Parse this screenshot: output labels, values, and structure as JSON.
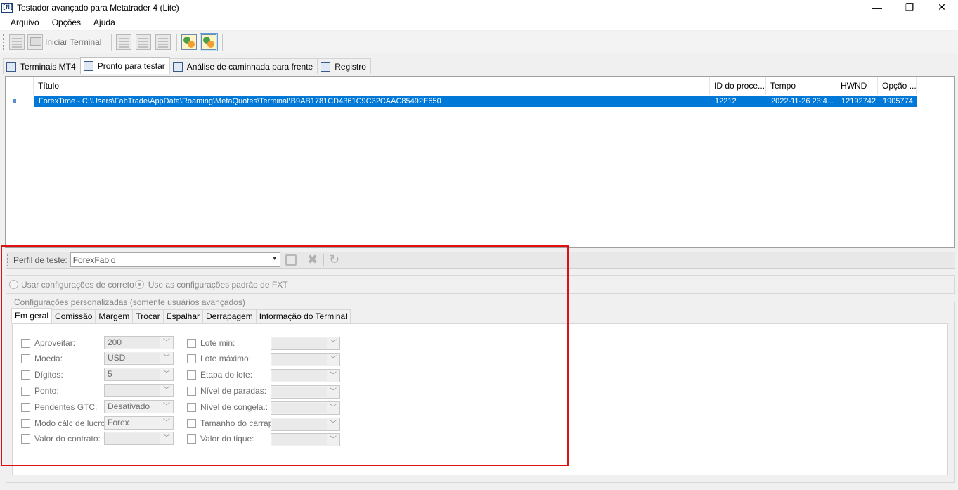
{
  "window": {
    "icon_text": "[N]",
    "title": "Testador avançado para Metatrader 4 (Lite)",
    "minimize": "—",
    "maximize": "❐",
    "close": "✕"
  },
  "menu": [
    "Arquivo",
    "Opções",
    "Ajuda"
  ],
  "toolbar": {
    "start_terminal_label": "Iniciar Terminal",
    "icons": [
      "add-terminal-icon",
      "start-terminal-icon",
      "edit-icon",
      "save-icon",
      "delete-icon",
      "view-terminal-icon",
      "link-terminal-icon"
    ]
  },
  "main_tabs": [
    "Terminais MT4",
    "Pronto para testar",
    "Análise de caminhada para frente",
    "Registro"
  ],
  "grid": {
    "columns": [
      "Título",
      "ID do proce...",
      "Tempo",
      "HWND",
      "Opção ..."
    ],
    "rows": [
      {
        "title": "ForexTime - C:\\Users\\FabTrade\\AppData\\Roaming\\MetaQuotes\\Terminal\\B9AB1781CD4361C9C32CAAC85492E650",
        "pid": "12212",
        "time": "2022-11-26 23:4...",
        "hwnd": "12192742",
        "option": "1905774",
        "selected": true
      }
    ]
  },
  "profile": {
    "label": "Perfil de teste:",
    "value": "ForexFabio"
  },
  "radios": {
    "use_broker": "Usar configurações de correto",
    "use_fxt": "Use as configurações padrão de FXT",
    "selected": "use_fxt"
  },
  "custom_settings": {
    "title": "Configurações personalizadas (somente usuários avançados)",
    "tabs": [
      "Em geral",
      "Comissão",
      "Margem",
      "Trocar",
      "Espalhar",
      "Derrapagem",
      "Informação do Terminal"
    ],
    "left_fields": [
      {
        "label": "Aproveitar:",
        "value": "200"
      },
      {
        "label": "Moeda:",
        "value": "USD"
      },
      {
        "label": "Dígitos:",
        "value": "5"
      },
      {
        "label": "Ponto:",
        "value": ""
      },
      {
        "label": "Pendentes GTC:",
        "value": "Desativado"
      },
      {
        "label": "Modo cálc de lucro:",
        "value": "Forex"
      },
      {
        "label": "Valor do contrato:",
        "value": ""
      }
    ],
    "right_fields": [
      {
        "label": "Lote min:",
        "value": ""
      },
      {
        "label": "Lote máximo:",
        "value": ""
      },
      {
        "label": "Etapa do lote:",
        "value": ""
      },
      {
        "label": "Nível de paradas:",
        "value": ""
      },
      {
        "label": "Nível de congela.:",
        "value": ""
      },
      {
        "label": "Tamanho do carrap:",
        "value": ""
      },
      {
        "label": "Valor do tique:",
        "value": ""
      }
    ]
  },
  "colors": {
    "selection": "#0078d7",
    "highlight_border": "#e01010"
  }
}
